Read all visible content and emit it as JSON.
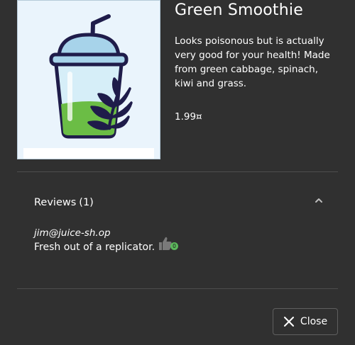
{
  "product": {
    "name": "Green Smoothie",
    "description": "Looks poisonous but is actually very good for your health! Made from green cabbage, spinach, kiwi and grass.",
    "price": "1.99¤"
  },
  "reviews": {
    "title": "Reviews",
    "count": "(1)",
    "items": [
      {
        "author": "jim@juice-sh.op",
        "text": "Fresh out of a replicator.",
        "likes": "0"
      }
    ]
  },
  "actions": {
    "close_label": "Close"
  },
  "icons": {
    "product": "smoothie-cup-icon",
    "expand": "chevron-up-icon",
    "like": "thumbs-up-icon",
    "close": "close-icon"
  },
  "colors": {
    "background": "#303030",
    "divider": "#4d4d4d",
    "badge": "#5cb85c",
    "cup_outline": "#1f1c4a",
    "smoothie": "#6bbd45"
  }
}
